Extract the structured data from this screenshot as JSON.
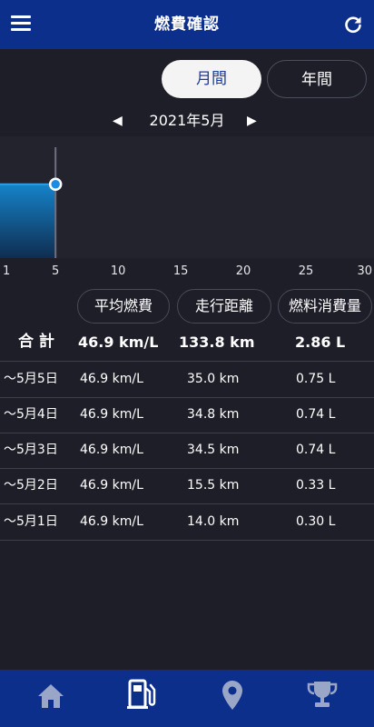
{
  "header": {
    "title": "燃費確認",
    "menu_icon": "menu-icon",
    "refresh_icon": "refresh-icon"
  },
  "period_tabs": [
    {
      "label": "月間",
      "active": true
    },
    {
      "label": "年間",
      "active": false
    }
  ],
  "month_nav": {
    "prev": "◀",
    "label": "2021年5月",
    "next": "▶"
  },
  "chart_data": {
    "type": "area",
    "x_ticks": [
      "1",
      "5",
      "10",
      "15",
      "20",
      "25",
      "30"
    ],
    "xlim": [
      1,
      30
    ],
    "points": [
      {
        "x": 5,
        "y": 46.9
      }
    ],
    "selected_x": 5,
    "colors": {
      "fill_top": "#1583c9",
      "fill_bottom": "#0f2d50",
      "marker": "#1e8be0"
    }
  },
  "columns": [
    "平均燃費",
    "走行距離",
    "燃料消費量"
  ],
  "total": {
    "label": "合 計",
    "fuel_economy": "46.9 km/L",
    "distance": "133.8 km",
    "fuel": "2.86 L"
  },
  "rows": [
    {
      "date": "〜5月5日",
      "fuel_economy": "46.9 km/L",
      "distance": "35.0 km",
      "fuel": "0.75 L"
    },
    {
      "date": "〜5月4日",
      "fuel_economy": "46.9 km/L",
      "distance": "34.8 km",
      "fuel": "0.74 L"
    },
    {
      "date": "〜5月3日",
      "fuel_economy": "46.9 km/L",
      "distance": "34.5 km",
      "fuel": "0.74 L"
    },
    {
      "date": "〜5月2日",
      "fuel_economy": "46.9 km/L",
      "distance": "15.5 km",
      "fuel": "0.33 L"
    },
    {
      "date": "〜5月1日",
      "fuel_economy": "46.9 km/L",
      "distance": "14.0 km",
      "fuel": "0.30 L"
    }
  ],
  "bottom_nav": [
    {
      "icon": "home-icon",
      "active": false
    },
    {
      "icon": "fuel-pump-icon",
      "active": true
    },
    {
      "icon": "map-pin-icon",
      "active": false
    },
    {
      "icon": "trophy-icon",
      "active": false
    }
  ],
  "colors": {
    "header_bg": "#0d2f8c",
    "background": "#1e1e28",
    "active_tab_text": "#1a3c9c"
  }
}
